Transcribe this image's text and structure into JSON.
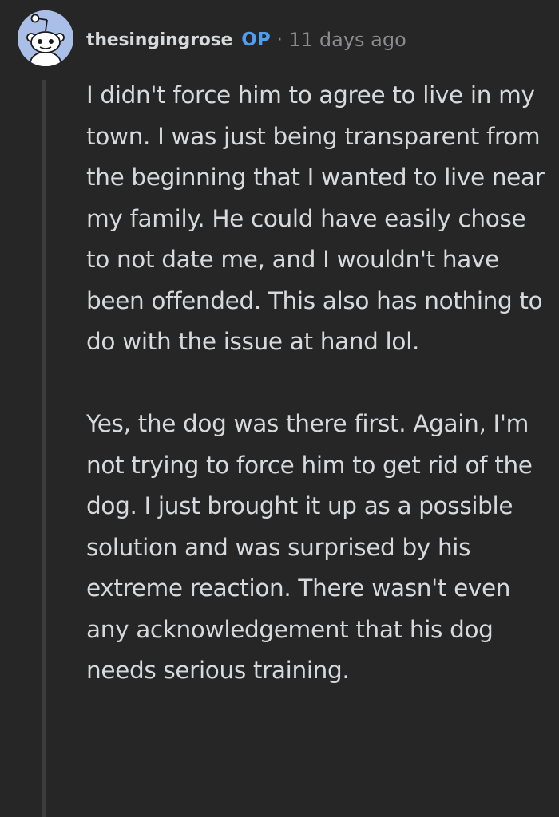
{
  "comment": {
    "author": "thesingingrose",
    "op_badge": "OP",
    "separator": "·",
    "timestamp": "11 days ago",
    "avatar_icon": "reddit-snoo-avatar",
    "body": [
      "I didn't force him to agree to live in my town. I was just being transparent from the beginning that I wanted to live near my family. He could have easily chose to not date me, and I wouldn't have been offended. This also has nothing to do with the issue at hand lol.",
      "Yes, the dog was there first. Again, I'm not trying to force him to get rid of the dog. I just brought it up as a possible solution and was surprised by his extreme reaction. There wasn't even any acknowledgement that his dog needs serious training."
    ]
  },
  "colors": {
    "background": "#262626",
    "text": "#d7dadc",
    "op_badge": "#4f9ef0",
    "meta": "#8a8c8e",
    "thread_line": "#3c3c3c",
    "avatar_bg": "#a9bfe8"
  }
}
